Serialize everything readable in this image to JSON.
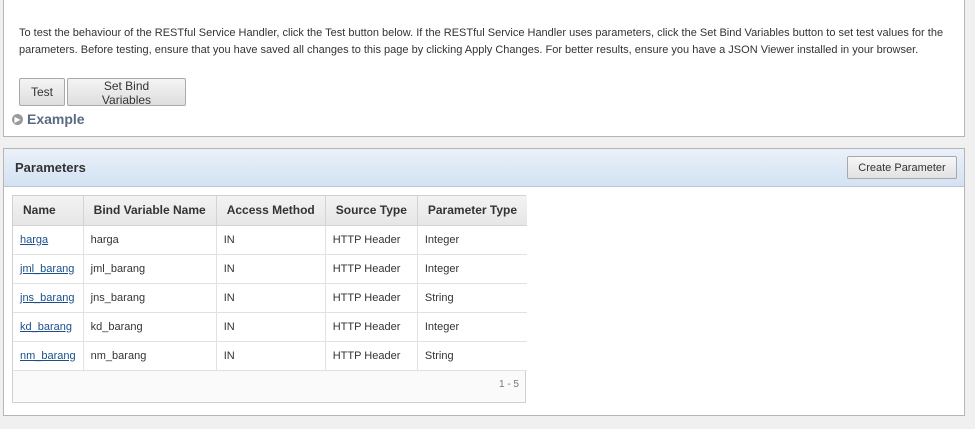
{
  "test_region": {
    "help_text": "To test the behaviour of the RESTful Service Handler, click the Test button below. If the RESTful Service Handler uses parameters, click the Set Bind Variables button to set test values for the parameters. Before testing, ensure that you have saved all changes to this page by clicking Apply Changes. For better results, ensure you have a JSON Viewer installed in your browser.",
    "test_label": "Test",
    "set_bind_label": "Set Bind Variables",
    "example_label": "Example"
  },
  "parameters": {
    "title": "Parameters",
    "create_label": "Create Parameter",
    "columns": [
      "Name",
      "Bind Variable Name",
      "Access Method",
      "Source Type",
      "Parameter Type"
    ],
    "rows": [
      [
        "harga",
        "harga",
        "IN",
        "HTTP Header",
        "Integer"
      ],
      [
        "jml_barang",
        "jml_barang",
        "IN",
        "HTTP Header",
        "Integer"
      ],
      [
        "jns_barang",
        "jns_barang",
        "IN",
        "HTTP Header",
        "String"
      ],
      [
        "kd_barang",
        "kd_barang",
        "IN",
        "HTTP Header",
        "Integer"
      ],
      [
        "nm_barang",
        "nm_barang",
        "IN",
        "HTTP Header",
        "String"
      ]
    ],
    "pagination": "1 - 5"
  }
}
